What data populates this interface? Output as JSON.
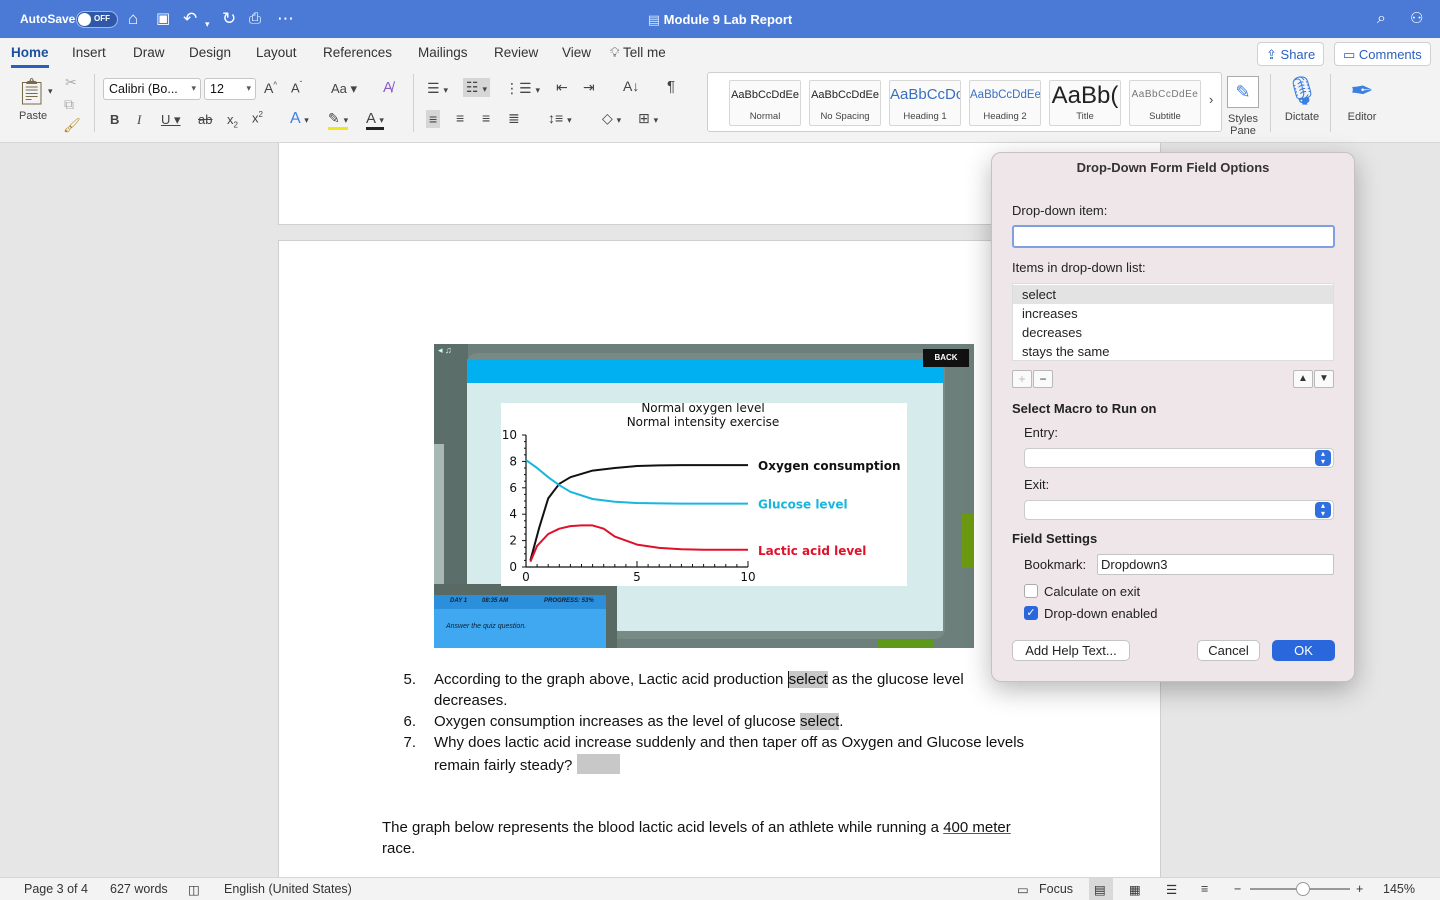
{
  "titlebar": {
    "autosave_label": "AutoSave",
    "autosave_state": "OFF",
    "document_title": "Module 9 Lab Report"
  },
  "ribbon_tabs": [
    "Home",
    "Insert",
    "Draw",
    "Design",
    "Layout",
    "References",
    "Mailings",
    "Review",
    "View"
  ],
  "tell_me": "Tell me",
  "share_label": "Share",
  "comments_label": "Comments",
  "ribbon": {
    "paste_label": "Paste",
    "font_name": "Calibri (Bo...",
    "font_size": "12",
    "styles": [
      {
        "sample": "AaBbCcDdEe",
        "name": "Normal"
      },
      {
        "sample": "AaBbCcDdEe",
        "name": "No Spacing"
      },
      {
        "sample": "AaBbCcDc",
        "name": "Heading 1"
      },
      {
        "sample": "AaBbCcDdEe",
        "name": "Heading 2"
      },
      {
        "sample": "AaBb(",
        "name": "Title"
      },
      {
        "sample": "AaBbCcDdEe",
        "name": "Subtitle"
      }
    ],
    "styles_pane_label": "Styles\nPane",
    "dictate_label": "Dictate",
    "editor_label": "Editor"
  },
  "figure": {
    "back_label": "BACK",
    "day_label": "DAY 1",
    "time_label": "08:35 AM",
    "progress_label": "PROGRESS: 53%",
    "prompt": "Answer the quiz question."
  },
  "chart_data": {
    "type": "line",
    "title": "Normal oxygen level\nNormal intensity exercise",
    "xlabel": "",
    "ylabel": "",
    "xlim": [
      0,
      10
    ],
    "ylim": [
      0,
      10
    ],
    "x_ticks": [
      0,
      5,
      10
    ],
    "y_ticks": [
      0,
      2,
      4,
      6,
      8,
      10
    ],
    "series": [
      {
        "name": "Oxygen consumption",
        "color": "#111111",
        "x": [
          0.2,
          0.6,
          1.0,
          1.5,
          2.0,
          3.0,
          4.0,
          5.0,
          6.0,
          7.0,
          8.0,
          9.0,
          10.0
        ],
        "y": [
          0.5,
          3.0,
          5.2,
          6.3,
          6.8,
          7.3,
          7.5,
          7.65,
          7.7,
          7.72,
          7.72,
          7.72,
          7.72
        ]
      },
      {
        "name": "Glucose level",
        "color": "#19b6dc",
        "x": [
          0.0,
          0.5,
          1.0,
          1.5,
          2.0,
          3.0,
          4.0,
          5.0,
          6.0,
          7.0,
          8.0,
          9.0,
          10.0
        ],
        "y": [
          8.1,
          7.5,
          6.8,
          6.2,
          5.7,
          5.15,
          4.95,
          4.85,
          4.82,
          4.8,
          4.8,
          4.8,
          4.8
        ]
      },
      {
        "name": "Lactic acid level",
        "color": "#e0102a",
        "x": [
          0.2,
          0.5,
          1.0,
          1.5,
          2.0,
          2.5,
          3.0,
          3.5,
          4.0,
          5.0,
          6.0,
          7.0,
          8.0,
          9.0,
          10.0
        ],
        "y": [
          0.4,
          1.6,
          2.5,
          2.9,
          3.1,
          3.15,
          3.15,
          2.9,
          2.3,
          1.7,
          1.45,
          1.35,
          1.3,
          1.3,
          1.3
        ]
      }
    ]
  },
  "questions": [
    {
      "num": "5.",
      "before": "According to the graph above, Lactic acid production ",
      "field": "select",
      "after": " as the glucose level",
      "line2": "decreases."
    },
    {
      "num": "6.",
      "before": "Oxygen consumption increases as the level of glucose ",
      "field": "select",
      "after": "."
    },
    {
      "num": "7.",
      "line1": "Why does lactic acid increase suddenly and then taper off as Oxygen and Glucose levels",
      "line2": "remain fairly steady?"
    }
  ],
  "paragraph": {
    "before": "The graph below represents the blood lactic acid levels of an athlete while running a ",
    "link": "400 meter",
    "line2": "race."
  },
  "status": {
    "page": "Page 3 of 4",
    "words": "627 words",
    "language": "English (United States)",
    "focus": "Focus",
    "zoom": "145%"
  },
  "dialog": {
    "title": "Drop-Down Form Field Options",
    "dropdown_item_label": "Drop-down item:",
    "dropdown_item_value": "",
    "items_label": "Items in drop-down list:",
    "items": [
      "select",
      "increases",
      "decreases",
      "stays the same"
    ],
    "macro_label": "Select Macro to Run on",
    "entry_label": "Entry:",
    "exit_label": "Exit:",
    "field_settings_label": "Field Settings",
    "bookmark_label": "Bookmark:",
    "bookmark_value": "Dropdown3",
    "calculate_label": "Calculate on exit",
    "calculate_checked": false,
    "enabled_label": "Drop-down enabled",
    "enabled_checked": true,
    "help_button": "Add Help Text...",
    "cancel_button": "Cancel",
    "ok_button": "OK"
  }
}
